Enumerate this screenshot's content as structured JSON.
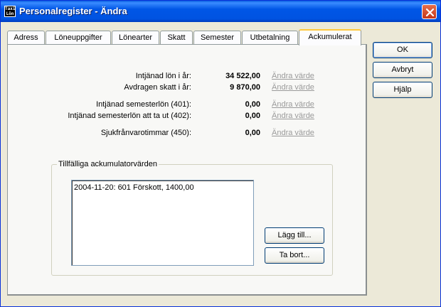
{
  "window": {
    "title": "Personalregister - Ändra",
    "icon_text_line1": "Taxi",
    "icon_text_line2": "Lön"
  },
  "tabs": [
    {
      "label": "Adress"
    },
    {
      "label": "Löneuppgifter"
    },
    {
      "label": "Lönearter"
    },
    {
      "label": "Skatt"
    },
    {
      "label": "Semester"
    },
    {
      "label": "Utbetalning"
    },
    {
      "label": "Ackumulerat",
      "active": true
    }
  ],
  "accumulated": {
    "earned_salary": {
      "label": "Intjänad lön i år:",
      "value": "34 522,00",
      "link": "Ändra värde"
    },
    "deducted_tax": {
      "label": "Avdragen skatt i år:",
      "value": "9 870,00",
      "link": "Ändra värde"
    },
    "vacation_pay": {
      "label": "Intjänad semesterlön (401):",
      "value": "0,00",
      "link": "Ändra värde"
    },
    "vacation_pay_withdraw": {
      "label": "Intjänad semesterlön att ta ut (402):",
      "value": "0,00",
      "link": "Ändra värde"
    },
    "sick_hours": {
      "label": "Sjukfrånvarotimmar (450):",
      "value": "0,00",
      "link": "Ändra värde"
    }
  },
  "temp_accumulators": {
    "group_title": "Tillfälliga ackumulatorvärden",
    "items": [
      "2004-11-20: 601 Förskott, 1400,00"
    ],
    "add_button": "Lägg till...",
    "remove_button": "Ta bort..."
  },
  "dialog_buttons": {
    "ok": "OK",
    "cancel": "Avbryt",
    "help": "Hjälp"
  },
  "colors": {
    "titlebar": "#0054e3",
    "disabled_link": "#9a9a9a",
    "active_tab_accent": "#ffc83c"
  }
}
